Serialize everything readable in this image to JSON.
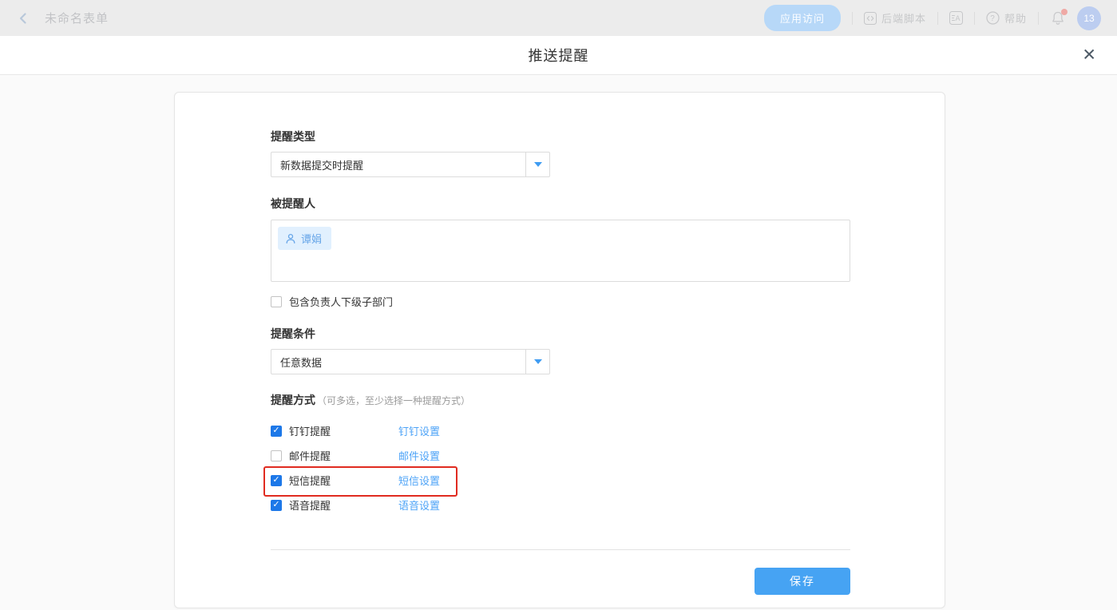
{
  "header": {
    "form_title": "未命名表单",
    "app_access_label": "应用访问",
    "backend_script_label": "后端脚本",
    "help_label": "帮助",
    "notification_badge": "13"
  },
  "dialog": {
    "title": "推送提醒",
    "close_glyph": "✕"
  },
  "form": {
    "reminder_type": {
      "label": "提醒类型",
      "value": "新数据提交时提醒"
    },
    "reminded_people": {
      "label": "被提醒人",
      "tags": [
        {
          "name": "谭娟"
        }
      ]
    },
    "include_sub_dept": {
      "label": "包含负责人下级子部门",
      "checked": false
    },
    "reminder_condition": {
      "label": "提醒条件",
      "value": "任意数据"
    },
    "reminder_methods": {
      "label": "提醒方式",
      "hint": "（可多选，至少选择一种提醒方式）",
      "items": [
        {
          "label": "钉钉提醒",
          "link": "钉钉设置",
          "checked": true,
          "highlighted": false
        },
        {
          "label": "邮件提醒",
          "link": "邮件设置",
          "checked": false,
          "highlighted": false
        },
        {
          "label": "短信提醒",
          "link": "短信设置",
          "checked": true,
          "highlighted": true
        },
        {
          "label": "语音提醒",
          "link": "语音设置",
          "checked": true,
          "highlighted": false
        }
      ]
    },
    "save_label": "保存",
    "check_glyph": "✓"
  },
  "colors": {
    "accent_blue": "#1d78e8",
    "link_blue": "#4da3f7",
    "button_blue": "#46a3f3",
    "highlight_red": "#e02b20",
    "tag_bg": "#e1f0fe",
    "header_bg": "#ececec"
  }
}
